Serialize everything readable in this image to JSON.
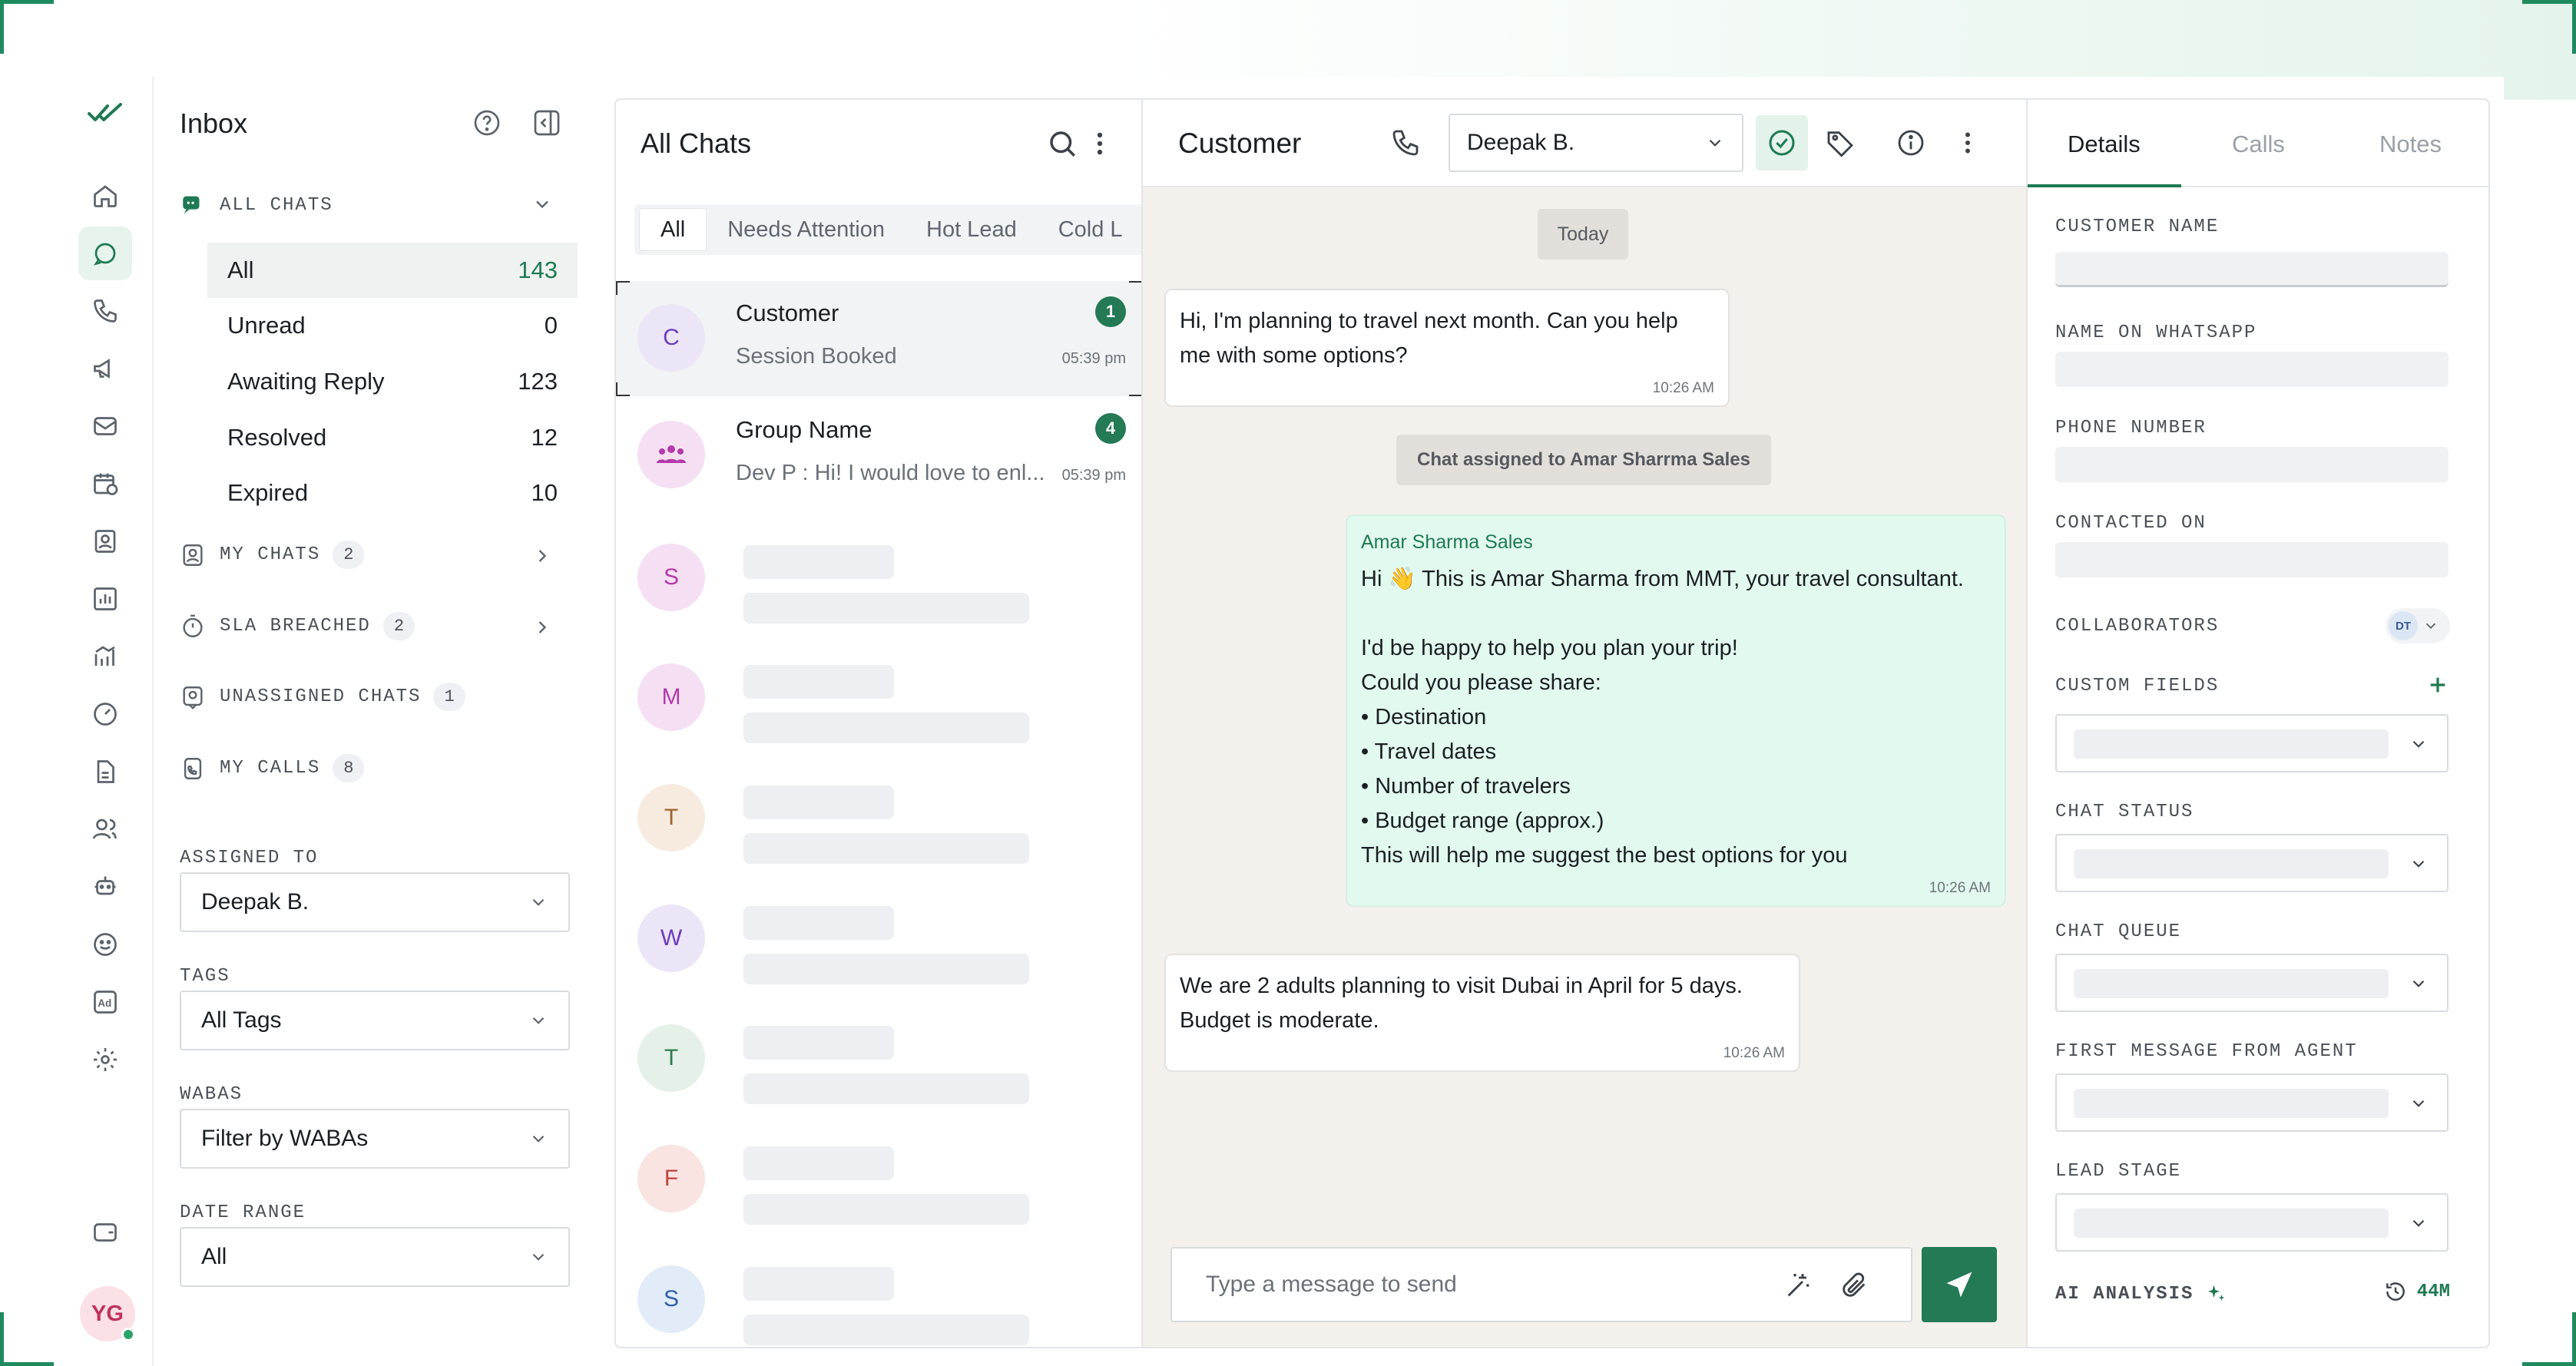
{
  "colors": {
    "brand": "#237a55",
    "accent_light": "#e7f4ee",
    "outgoing_bubble": "#e1f9ee",
    "chat_bg": "#f4f1ec"
  },
  "sidebar": {
    "icons": [
      "double-check-logo-icon",
      "home-icon",
      "chats-icon",
      "phone-icon",
      "megaphone-icon",
      "mail-icon",
      "calendar-clock-icon",
      "contact-card-icon",
      "bar-chart-icon",
      "analytics-icon",
      "speedometer-icon",
      "document-icon",
      "users-icon",
      "bot-icon",
      "face-settings-icon",
      "ad-icon",
      "gear-icon",
      "wallet-icon"
    ],
    "user_initials": "YG"
  },
  "filters": {
    "title": "Inbox",
    "all_chats_label": "ALL CHATS",
    "rows": [
      {
        "label": "All",
        "count": "143"
      },
      {
        "label": "Unread",
        "count": "0"
      },
      {
        "label": "Awaiting Reply",
        "count": "123"
      },
      {
        "label": "Resolved",
        "count": "12"
      },
      {
        "label": "Expired",
        "count": "10"
      }
    ],
    "my_chats": {
      "label": "MY CHATS",
      "count": "2"
    },
    "sla": {
      "label": "SLA BREACHED",
      "count": "2"
    },
    "unassigned": {
      "label": "UNASSIGNED CHATS",
      "count": "1"
    },
    "my_calls": {
      "label": "MY CALLS",
      "count": "8"
    },
    "assigned_to_label": "ASSIGNED TO",
    "assigned_to_value": "Deepak B.",
    "tags_label": "TAGS",
    "tags_value": "All Tags",
    "wabas_label": "WABAS",
    "wabas_value": "Filter by WABAs",
    "date_range_label": "DATE RANGE",
    "date_range_value": "All"
  },
  "chat_list": {
    "title": "All Chats",
    "tabs": [
      "All",
      "Needs Attention",
      "Hot Lead",
      "Cold L"
    ],
    "chats": [
      {
        "initial": "C",
        "name": "Customer",
        "preview": "Session Booked",
        "time": "05:39 pm",
        "badge": "1"
      },
      {
        "initial": "",
        "name": "Group Name",
        "preview": "Dev P : Hi! I would love to enl...",
        "time": "05:39 pm",
        "badge": "4"
      }
    ],
    "placeholders": [
      "S",
      "M",
      "T",
      "W",
      "T",
      "F",
      "S"
    ]
  },
  "conversation": {
    "title": "Customer",
    "agent": "Deepak B.",
    "date_pill": "Today",
    "msg1": {
      "line1": "Hi, I'm planning to travel next month. Can you help",
      "line2": "me with some options?",
      "time": "10:26 AM"
    },
    "system_note": "Chat assigned to Amar Sharrma Sales",
    "msg2": {
      "sender": "Amar Sharma Sales",
      "l1a": "Hi",
      "emoji": "👋",
      "l1b": "This is Amar Sharma from MMT, your travel consultant.",
      "l2": "I'd be happy to help you plan your trip!",
      "l3": "Could you please share:",
      "b1": "• Destination",
      "b2": "• Travel dates",
      "b3": "• Number of travelers",
      "b4": "• Budget range (approx.)",
      "l4": "This will help me suggest the best options for you",
      "time": "10:26 AM"
    },
    "msg3": {
      "line1": "We are 2 adults planning to visit Dubai in April for 5 days.",
      "line2": "Budget is moderate.",
      "time": "10:26 AM"
    },
    "composer_placeholder": "Type a message to send"
  },
  "details": {
    "tabs": [
      "Details",
      "Calls",
      "Notes"
    ],
    "customer_name": "CUSTOMER NAME",
    "name_on_whatsapp": "NAME ON WHATSAPP",
    "phone_number": "PHONE NUMBER",
    "contacted_on": "CONTACTED ON",
    "collaborators": "COLLABORATORS",
    "collaborator_initials": "DT",
    "custom_fields": "CUSTOM FIELDS",
    "chat_status": "CHAT STATUS",
    "chat_queue": "CHAT QUEUE",
    "first_message": "FIRST MESSAGE FROM AGENT",
    "lead_stage": "LEAD STAGE",
    "ai_analysis": "AI ANALYSIS",
    "timer": "44M"
  }
}
